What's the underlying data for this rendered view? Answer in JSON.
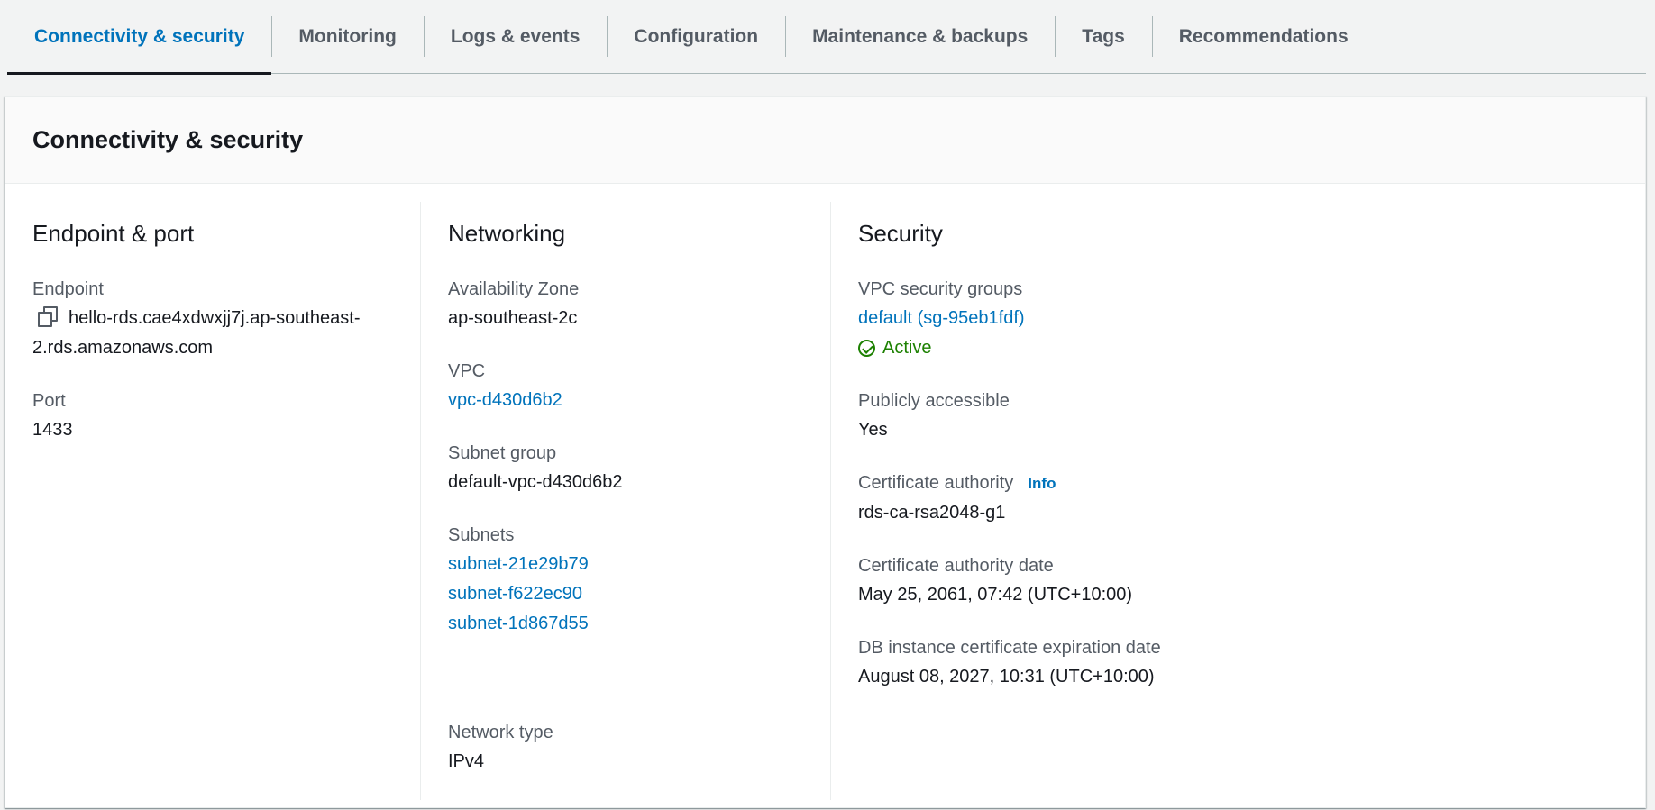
{
  "tabs": [
    {
      "label": "Connectivity & security",
      "active": true
    },
    {
      "label": "Monitoring"
    },
    {
      "label": "Logs & events"
    },
    {
      "label": "Configuration"
    },
    {
      "label": "Maintenance & backups"
    },
    {
      "label": "Tags"
    },
    {
      "label": "Recommendations"
    }
  ],
  "panel": {
    "title": "Connectivity & security"
  },
  "endpoint_port": {
    "title": "Endpoint & port",
    "endpoint_label": "Endpoint",
    "endpoint_value": "hello-rds.cae4xdwxjj7j.ap-southeast-2.rds.amazonaws.com",
    "port_label": "Port",
    "port_value": "1433"
  },
  "networking": {
    "title": "Networking",
    "az_label": "Availability Zone",
    "az_value": "ap-southeast-2c",
    "vpc_label": "VPC",
    "vpc_value": "vpc-d430d6b2",
    "subnet_group_label": "Subnet group",
    "subnet_group_value": "default-vpc-d430d6b2",
    "subnets_label": "Subnets",
    "subnets": [
      "subnet-21e29b79",
      "subnet-f622ec90",
      "subnet-1d867d55"
    ],
    "network_type_label": "Network type",
    "network_type_value": "IPv4"
  },
  "security": {
    "title": "Security",
    "sg_label": "VPC security groups",
    "sg_value": "default (sg-95eb1fdf)",
    "sg_status": "Active",
    "public_label": "Publicly accessible",
    "public_value": "Yes",
    "ca_label": "Certificate authority",
    "ca_info": "Info",
    "ca_value": "rds-ca-rsa2048-g1",
    "ca_date_label": "Certificate authority date",
    "ca_date_value": "May 25, 2061, 07:42 (UTC+10:00)",
    "expiry_label": "DB instance certificate expiration date",
    "expiry_value": "August 08, 2027, 10:31 (UTC+10:00)"
  },
  "colors": {
    "link": "#0073bb",
    "success": "#1d8102",
    "text": "#16191f",
    "label": "#545b64"
  },
  "icons": {
    "copy": "copy-icon",
    "status": "check-circle-icon"
  }
}
